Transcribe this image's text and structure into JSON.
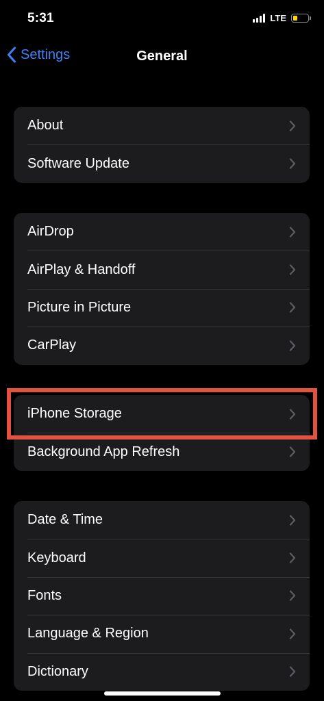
{
  "status_bar": {
    "time": "5:31",
    "network": "LTE",
    "battery_color": "#ffd60a"
  },
  "nav": {
    "back_label": "Settings",
    "title": "General",
    "accent_color": "#3d82f6"
  },
  "groups": [
    {
      "items": [
        {
          "label": "About"
        },
        {
          "label": "Software Update"
        }
      ]
    },
    {
      "items": [
        {
          "label": "AirDrop"
        },
        {
          "label": "AirPlay & Handoff"
        },
        {
          "label": "Picture in Picture"
        },
        {
          "label": "CarPlay"
        }
      ]
    },
    {
      "items": [
        {
          "label": "iPhone Storage",
          "highlighted": true
        },
        {
          "label": "Background App Refresh"
        }
      ]
    },
    {
      "items": [
        {
          "label": "Date & Time"
        },
        {
          "label": "Keyboard"
        },
        {
          "label": "Fonts"
        },
        {
          "label": "Language & Region"
        },
        {
          "label": "Dictionary"
        }
      ]
    }
  ],
  "highlight_color": "#e25241"
}
